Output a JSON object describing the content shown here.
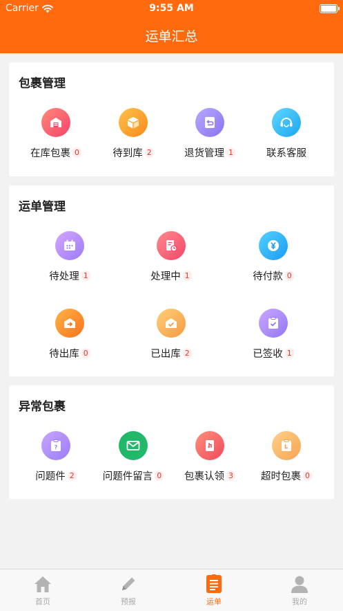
{
  "status": {
    "carrier": "Carrier",
    "time": "9:55 AM"
  },
  "header": {
    "title": "运单汇总"
  },
  "sections": [
    {
      "title": "包裹管理",
      "items": [
        {
          "label": "在库包裹",
          "badge": "0",
          "icon": "warehouse-icon"
        },
        {
          "label": "待到库",
          "badge": "2",
          "icon": "box-icon"
        },
        {
          "label": "退货管理",
          "badge": "1",
          "icon": "return-icon"
        },
        {
          "label": "联系客服",
          "badge": "",
          "icon": "headset-icon"
        }
      ]
    },
    {
      "title": "运单管理",
      "items": [
        {
          "label": "待处理",
          "badge": "1",
          "icon": "calendar-icon"
        },
        {
          "label": "处理中",
          "badge": "1",
          "icon": "processing-doc-icon"
        },
        {
          "label": "待付款",
          "badge": "0",
          "icon": "yen-icon"
        },
        {
          "label": "待出库",
          "badge": "0",
          "icon": "outbound-icon"
        },
        {
          "label": "已出库",
          "badge": "2",
          "icon": "shipped-icon"
        },
        {
          "label": "已签收",
          "badge": "1",
          "icon": "signed-icon"
        }
      ]
    },
    {
      "title": "异常包裹",
      "items": [
        {
          "label": "问题件",
          "badge": "2",
          "icon": "question-icon"
        },
        {
          "label": "问题件留言",
          "badge": "0",
          "icon": "mail-icon"
        },
        {
          "label": "包裹认领",
          "badge": "3",
          "icon": "claim-icon"
        },
        {
          "label": "超时包裹",
          "badge": "0",
          "icon": "timeout-icon"
        }
      ]
    }
  ],
  "tabs": [
    {
      "label": "首页",
      "icon": "home-icon"
    },
    {
      "label": "预报",
      "icon": "pencil-icon"
    },
    {
      "label": "运单",
      "icon": "waybill-icon",
      "active": true
    },
    {
      "label": "我的",
      "icon": "user-icon"
    }
  ],
  "colors": {
    "brand": "#ff6a0e",
    "badge_text": "#e23a2e",
    "badge_bg": "#fdeeee"
  }
}
